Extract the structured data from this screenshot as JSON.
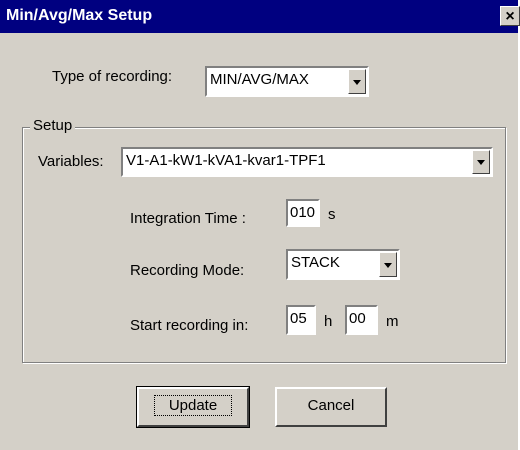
{
  "dialog": {
    "title": "Min/Avg/Max Setup",
    "close_label": "×"
  },
  "recording": {
    "label": "Type of recording:",
    "value": "MIN/AVG/MAX"
  },
  "setup": {
    "legend": "Setup",
    "variables_label": "Variables:",
    "variables_value": "V1-A1-kW1-kVA1-kvar1-TPF1",
    "integration_label": "Integration Time :",
    "integration_value": "010",
    "integration_unit": "s",
    "mode_label": "Recording Mode:",
    "mode_value": "STACK",
    "start_label": "Start recording in:",
    "start_hours": "05",
    "hours_unit": "h",
    "start_minutes": "00",
    "minutes_unit": "m"
  },
  "buttons": {
    "update": "Update",
    "cancel": "Cancel"
  }
}
